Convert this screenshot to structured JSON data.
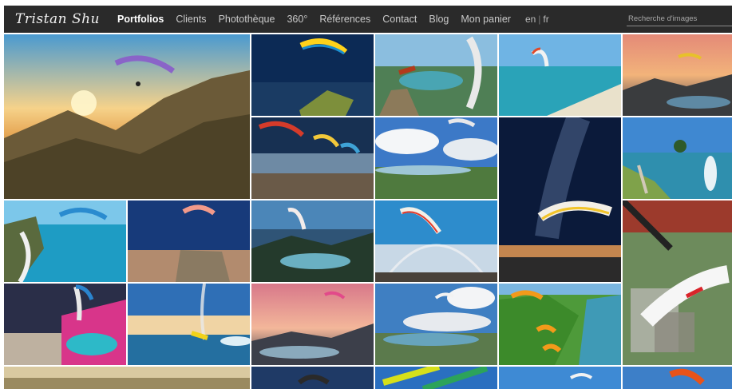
{
  "logo_text": "Tristan Shu",
  "nav": {
    "items": [
      {
        "label": "Portfolios",
        "active": true
      },
      {
        "label": "Clients"
      },
      {
        "label": "Photothèque"
      },
      {
        "label": "360°"
      },
      {
        "label": "Références"
      },
      {
        "label": "Contact"
      },
      {
        "label": "Blog"
      },
      {
        "label": "Mon panier"
      }
    ],
    "lang_en": "en",
    "lang_sep": "|",
    "lang_fr": "fr"
  },
  "search": {
    "placeholder": "Recherche d'images"
  },
  "colors": {
    "nav_bg": "#2a2a2a",
    "nav_text": "#c9c9c9",
    "nav_active": "#ffffff"
  },
  "gallery": {
    "photos": [
      {
        "subject": "paraglider-sunset-mountains"
      },
      {
        "subject": "paraglider-night-rock"
      },
      {
        "subject": "paraglider-pilot-lake-rock"
      },
      {
        "subject": "paraglider-lagoon-beach"
      },
      {
        "subject": "paraglider-sunset-lake"
      },
      {
        "subject": "paragliders-night-trails"
      },
      {
        "subject": "paraglider-clouds-valley"
      },
      {
        "subject": "paraglider-milky-way"
      },
      {
        "subject": "paraglider-acro-lake"
      },
      {
        "subject": "paraglider-turquoise-coast"
      },
      {
        "subject": "paraglider-bunker-sunset"
      },
      {
        "subject": "paraglider-dusk-lake"
      },
      {
        "subject": "paraglider-rainbow-launch"
      },
      {
        "subject": "paraglider-harness-village"
      },
      {
        "subject": "paraglider-graffiti-wall"
      },
      {
        "subject": "paraglider-beach-trails"
      },
      {
        "subject": "paraglider-pink-lake"
      },
      {
        "subject": "paragliders-cloudy-lake"
      },
      {
        "subject": "paragliders-green-peaks"
      },
      {
        "subject": "paraglider-bottom-row-1"
      },
      {
        "subject": "paraglider-bottom-row-2"
      },
      {
        "subject": "paraglider-bottom-row-3"
      },
      {
        "subject": "paraglider-bottom-row-4"
      },
      {
        "subject": "paraglider-bottom-row-5"
      }
    ]
  }
}
